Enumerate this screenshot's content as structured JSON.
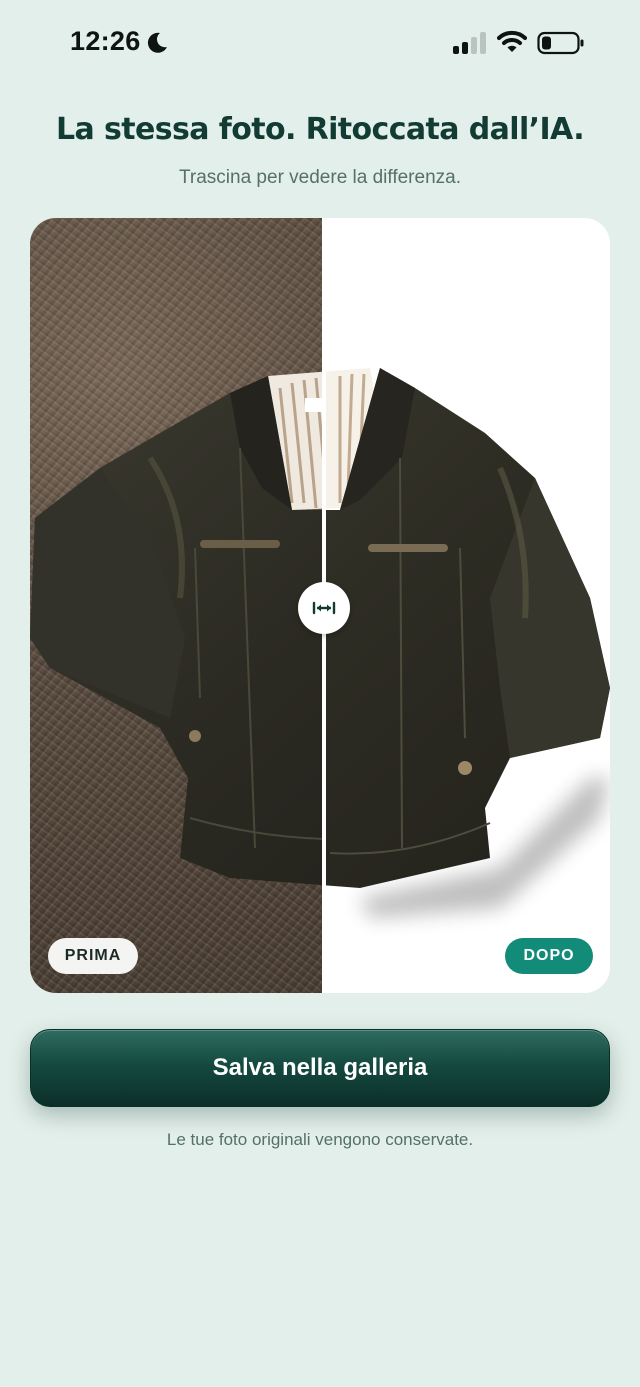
{
  "status_bar": {
    "time": "12:26",
    "icons": [
      "moon-icon",
      "signal-icon",
      "wifi-icon",
      "battery-icon"
    ]
  },
  "header": {
    "title": "La stessa foto. Ritoccata dall’IA.",
    "subtitle": "Trascina per vedere la differenza."
  },
  "comparison": {
    "before_label": "PRIMA",
    "after_label": "DOPO",
    "handle_icon": "horizontal-arrows-icon",
    "slider_position": 0.5
  },
  "actions": {
    "save_label": "Salva nella galleria"
  },
  "footer": {
    "note": "Le tue foto originali vengono conservate."
  },
  "colors": {
    "background": "#e3efea",
    "title": "#123b33",
    "accent": "#138b79",
    "button": "#154a40"
  }
}
